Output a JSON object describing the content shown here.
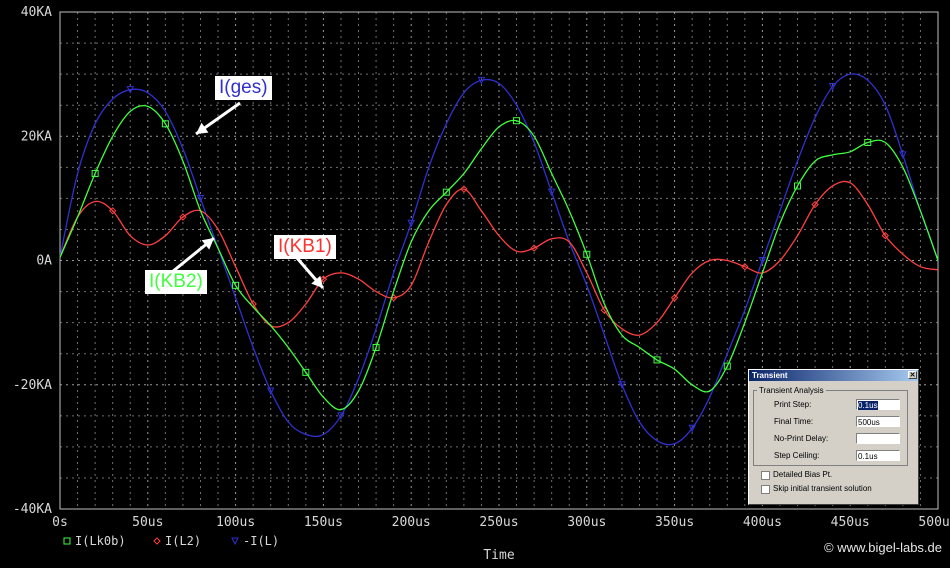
{
  "chart_data": {
    "type": "line",
    "xlabel": "Time",
    "ylabel": "",
    "xlim": [
      0,
      500
    ],
    "ylim": [
      -40,
      40
    ],
    "x_unit": "us",
    "y_unit": "KA",
    "xticks": [
      0,
      50,
      100,
      150,
      200,
      250,
      300,
      350,
      400,
      450,
      500
    ],
    "xtick_labels": [
      "0s",
      "50us",
      "100us",
      "150us",
      "200us",
      "250us",
      "300us",
      "350us",
      "400us",
      "450us",
      "500us"
    ],
    "yticks": [
      40,
      20,
      0,
      -20,
      -40
    ],
    "ytick_labels": [
      "40KA",
      "20KA",
      "0A",
      "-20KA",
      "-40KA"
    ],
    "grid": true,
    "legend_position": "bottom-left",
    "series": [
      {
        "name": "I(Lk0b)",
        "color": "#40ff40",
        "marker": "square",
        "x": [
          0,
          10,
          20,
          30,
          40,
          50,
          60,
          70,
          80,
          90,
          100,
          110,
          120,
          130,
          140,
          150,
          160,
          170,
          180,
          190,
          200,
          210,
          220,
          230,
          240,
          250,
          260,
          270,
          280,
          290,
          300,
          310,
          320,
          330,
          340,
          350,
          360,
          370,
          380,
          390,
          400,
          410,
          420,
          430,
          440,
          450,
          460,
          470,
          480,
          490,
          500
        ],
        "y": [
          0.5,
          7,
          14,
          20,
          24,
          24.8,
          22,
          16,
          8,
          2,
          -4,
          -7.5,
          -10.5,
          -14,
          -18,
          -22,
          -24,
          -21,
          -14,
          -5,
          3,
          8,
          11,
          14,
          18,
          21.5,
          22.5,
          20,
          14,
          8,
          1,
          -7,
          -12,
          -14,
          -16,
          -17.5,
          -20,
          -21,
          -17,
          -10,
          -2,
          6,
          12,
          16,
          17,
          17.5,
          19,
          19,
          15,
          8,
          0
        ]
      },
      {
        "name": "I(L2)",
        "color": "#ff4040",
        "marker": "diamond",
        "x": [
          0,
          10,
          20,
          30,
          40,
          50,
          60,
          70,
          80,
          90,
          100,
          110,
          120,
          130,
          140,
          150,
          160,
          170,
          180,
          190,
          200,
          210,
          220,
          230,
          240,
          250,
          260,
          270,
          280,
          290,
          300,
          310,
          320,
          330,
          340,
          350,
          360,
          370,
          380,
          390,
          400,
          410,
          420,
          430,
          440,
          450,
          460,
          470,
          480,
          490,
          500
        ],
        "y": [
          0.5,
          7,
          9.5,
          8,
          4,
          2.5,
          4,
          7,
          8,
          5,
          -1,
          -7,
          -10.5,
          -10,
          -7,
          -3,
          -2,
          -3,
          -5,
          -6,
          -4,
          3,
          9,
          11.5,
          8,
          4,
          1.5,
          2,
          3.5,
          3,
          -2,
          -8,
          -11,
          -12,
          -10,
          -6,
          -2,
          0,
          0,
          -1,
          -2,
          0,
          4,
          9,
          12,
          12.5,
          9,
          4,
          1,
          -1,
          -1.5
        ]
      },
      {
        "name": "-I(L)",
        "color": "#3030d0",
        "marker": "triangle",
        "x": [
          0,
          10,
          20,
          30,
          40,
          50,
          60,
          70,
          80,
          90,
          100,
          110,
          120,
          130,
          140,
          150,
          160,
          170,
          180,
          190,
          200,
          210,
          220,
          230,
          240,
          250,
          260,
          270,
          280,
          290,
          300,
          310,
          320,
          330,
          340,
          350,
          360,
          370,
          380,
          390,
          400,
          410,
          420,
          430,
          440,
          450,
          460,
          470,
          480,
          490,
          500
        ],
        "y": [
          0.5,
          14,
          22,
          26,
          27.5,
          27,
          24,
          18,
          10,
          2,
          -6,
          -14,
          -21,
          -26,
          -28,
          -28,
          -25,
          -19,
          -11,
          -2,
          6,
          15,
          22,
          27,
          29,
          28.5,
          25,
          19,
          11,
          3,
          -4,
          -12,
          -20,
          -26,
          -29,
          -29.5,
          -27,
          -22,
          -15,
          -8,
          0,
          8,
          16,
          23,
          28,
          30,
          29,
          25,
          17,
          8,
          0
        ]
      }
    ],
    "annotations": [
      {
        "text": "I(ges)",
        "color": "#3030d0"
      },
      {
        "text": "I(KB2)",
        "color": "#40ff40"
      },
      {
        "text": "I(KB1)",
        "color": "#ff3030"
      }
    ]
  },
  "dialog": {
    "title": "Transient",
    "group_label": "Transient Analysis",
    "fields": [
      {
        "label": "Print Step:",
        "value": "0.1us",
        "selected": true
      },
      {
        "label": "Final Time:",
        "value": "500us",
        "selected": false
      },
      {
        "label": "No-Print Delay:",
        "value": "",
        "selected": false
      },
      {
        "label": "Step Ceiling:",
        "value": "0.1us",
        "selected": false
      }
    ],
    "checkboxes": [
      {
        "label": "Detailed Bias Pt.",
        "checked": false
      },
      {
        "label": "Skip initial transient solution",
        "checked": false
      }
    ]
  },
  "copyright": "© www.bigel-labs.de"
}
